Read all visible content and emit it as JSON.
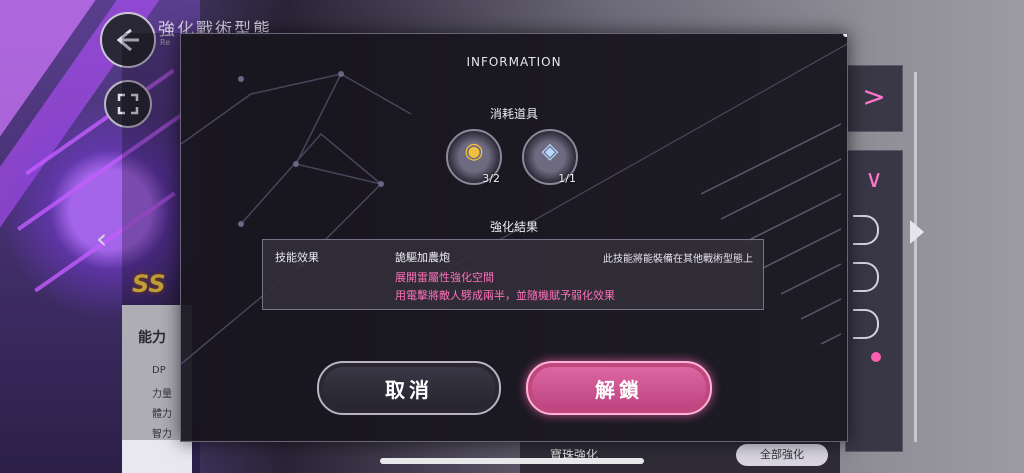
{
  "header": {
    "title": "強化戰術型態",
    "subtitle": "Re"
  },
  "side": {
    "rank_badge": "SS",
    "stats_title": "能力",
    "stats": [
      "DP",
      "力量",
      "體力",
      "智力"
    ]
  },
  "bottom": {
    "strip_label": "寶珠強化",
    "pill_label": "全部強化"
  },
  "modal": {
    "title": "INFORMATION",
    "consumables_label": "消耗道具",
    "items": [
      {
        "icon": "gold-medal-icon",
        "count": "3/2"
      },
      {
        "icon": "crystal-chip-icon",
        "count": "1/1"
      }
    ],
    "result_label": "強化結果",
    "result": {
      "type_label": "技能效果",
      "skill_name": "詭驅加農炮",
      "equip_note": "此技能將能裝備在其他戰術型態上",
      "effects": [
        "展開雷屬性強化空間",
        "用電擊將敵人劈成兩半，並隨機賦予弱化效果"
      ]
    },
    "buttons": {
      "cancel": "取消",
      "unlock": "解鎖"
    }
  },
  "colors": {
    "accent_pink": "#ff6fba",
    "unlock_button": "#d45a98",
    "modal_bg": "#18161e"
  }
}
